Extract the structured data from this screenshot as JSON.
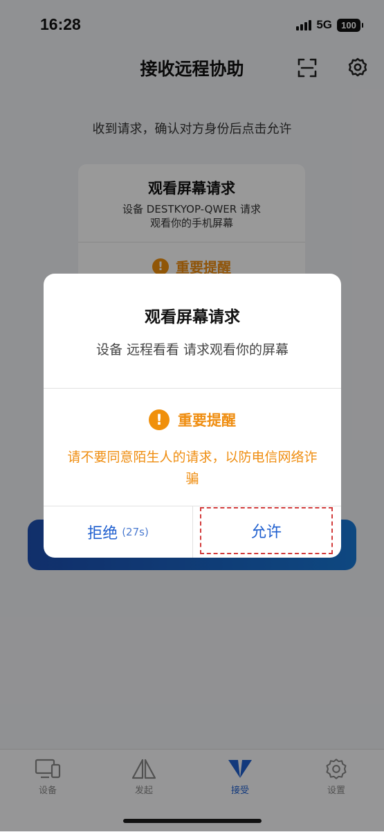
{
  "status_bar": {
    "time": "16:28",
    "network": "5G",
    "battery": "100"
  },
  "header": {
    "title": "接收远程协助",
    "scan_icon": "scan-icon",
    "settings_icon": "gear-icon"
  },
  "main": {
    "hint": "收到请求，确认对方身份后点击允许",
    "card": {
      "title": "观看屏幕请求",
      "desc_line1": "设备 DESTKYOP-QWER 请求",
      "desc_line2": "观看你的手机屏幕",
      "warning": "重要提醒"
    }
  },
  "dialog": {
    "title": "观看屏幕请求",
    "desc": "设备 远程看看 请求观看你的屏幕",
    "warning_icon": "!",
    "warning_title": "重要提醒",
    "warning_text": "请不要同意陌生人的请求，以防电信网络诈骗",
    "reject_label": "拒绝",
    "reject_countdown": "(27s)",
    "allow_label": "允许"
  },
  "tabbar": {
    "items": [
      {
        "label": "设备",
        "icon": "devices-icon",
        "active": false
      },
      {
        "label": "发起",
        "icon": "initiate-icon",
        "active": false
      },
      {
        "label": "接受",
        "icon": "receive-icon",
        "active": true
      },
      {
        "label": "设置",
        "icon": "settings-gear-icon",
        "active": false
      }
    ]
  },
  "colors": {
    "accent": "#1f5fcf",
    "warning": "#ef8d10",
    "highlight_border": "#d23b3b"
  }
}
